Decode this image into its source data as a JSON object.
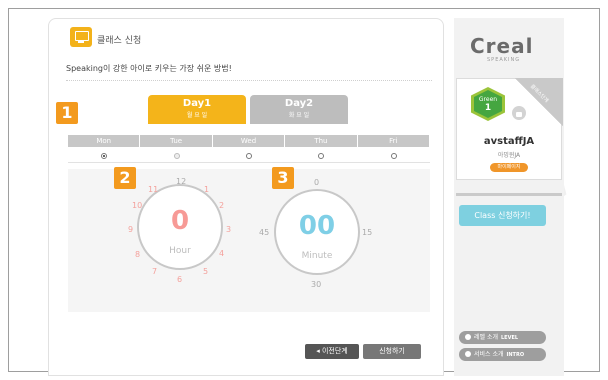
{
  "header": {
    "title": "클래스 신청",
    "subtitle": "Speaking이 강한 아이로 키우는 가장 쉬운 방법!"
  },
  "steps": {
    "one": "1",
    "two": "2",
    "three": "3"
  },
  "day_tabs": [
    {
      "label": "Day1",
      "sub": "월 요 일"
    },
    {
      "label": "Day2",
      "sub": "화 요 일"
    }
  ],
  "weekdays": [
    "Mon",
    "Tue",
    "Wed",
    "Thu",
    "Fri"
  ],
  "selected_weekday": "Mon",
  "disabled_weekday": "Tue",
  "hour_dial": {
    "value": "0",
    "unit": "Hour",
    "numbers": [
      "12",
      "1",
      "2",
      "3",
      "4",
      "5",
      "6",
      "7",
      "8",
      "9",
      "10",
      "11"
    ]
  },
  "minute_dial": {
    "value": "00",
    "unit": "Minute",
    "numbers": [
      "0",
      "15",
      "30",
      "45"
    ]
  },
  "buttons": {
    "prev": "◂ 이전단계",
    "apply": "신청하기"
  },
  "sidebar": {
    "logo": "Creal",
    "logo_sub": "SPEAKING",
    "corner_label": "클래스단계",
    "level_word": "Green",
    "level_num": "1",
    "username": "avstaffJA",
    "user_sub": "아밍윈JA",
    "mypage": "마이페이지",
    "class_button": "Class 신청하기!",
    "link_level": "레벨 소개",
    "link_level_tag": "LEVEL",
    "link_service": "서비스 소개",
    "link_service_tag": "INTRO"
  },
  "colors": {
    "accent": "#f4b41a",
    "hour": "#f79a96",
    "minute": "#7fcfe6",
    "level_green": "#45a640",
    "class_button": "#7ed0e0"
  }
}
